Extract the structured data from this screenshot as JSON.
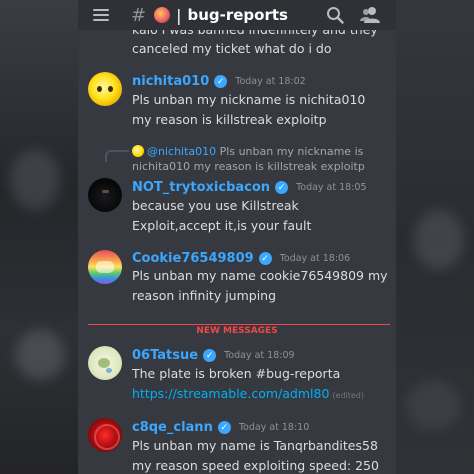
{
  "header": {
    "channel_name": "bug-reports",
    "separator": "|",
    "channel_icon": "hash-icon",
    "menu_icon": "hamburger-icon",
    "search_icon": "search-icon",
    "members_icon": "members-icon"
  },
  "messages": [
    {
      "continuation": "kaio i was banned indefinitely and they canceled my ticket what do i do"
    },
    {
      "username": "nichita010",
      "timestamp": "Today at 18:02",
      "text": "Pls unban my nickname is nichita010 my reason is killstreak exploitp"
    },
    {
      "reply_to": {
        "username": "@nichita010",
        "text": "Pls unban my nickname is nichita010 my reason is killstreak exploitp"
      },
      "username": "NOT_trytoxicbacon",
      "timestamp": "Today at 18:05",
      "text": "because you use Killstreak Exploit,accept it,is your fault"
    },
    {
      "username": "Cookie76549809",
      "timestamp": "Today at 18:06",
      "text": "Pls unban my name cookie76549809 my reason infinity jumping"
    },
    {
      "username": "06Tatsue",
      "timestamp": "Today at 18:09",
      "text": "The plate is broken #bug-reporta ",
      "link": "https://streamable.com/adml80",
      "edited": "(edited)"
    },
    {
      "username": "c8qe_clann",
      "timestamp": "Today at 18:10",
      "text": "Pls unban my name is Tanqrbandites58 my reason speed exploiting speed: 250"
    }
  ],
  "divider_label": "NEW MESSAGES",
  "colors": {
    "accent": "#3ba7ff",
    "new_messages": "#f04747",
    "background": "#36393f",
    "link": "#00b0f4"
  }
}
